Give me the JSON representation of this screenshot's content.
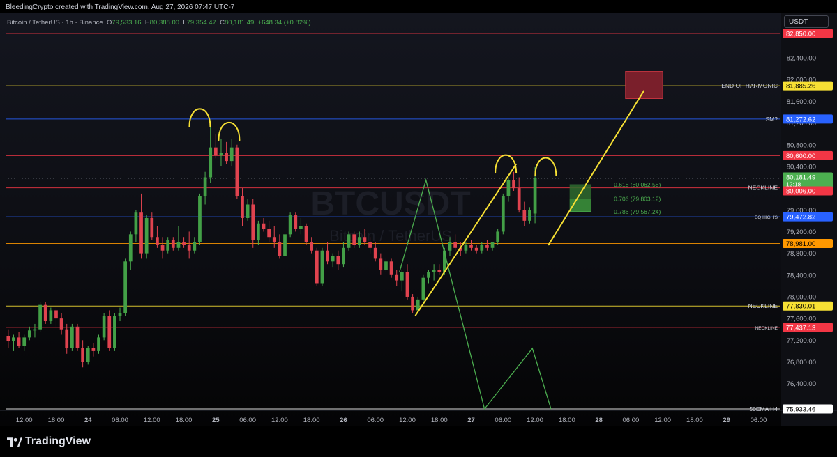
{
  "header": {
    "credit": "BleedingCrypto created with TradingView.com, Aug 27, 2026 07:47 UTC-7"
  },
  "legend": {
    "symbol": "Bitcoin / TetherUS · 1h · Binance",
    "o_label": "O",
    "o": "79,533.16",
    "h_label": "H",
    "h": "80,388.00",
    "l_label": "L",
    "l": "79,354.47",
    "c_label": "C",
    "c": "80,181.49",
    "change": "+648.34 (+0.82%)"
  },
  "currency": "USDT",
  "watermark": {
    "main": "BTCUSDT",
    "sub": "Bitcoin / TetherUS"
  },
  "brand": "TradingView",
  "chart_data": {
    "type": "candlestick",
    "ylim": [
      75933.46,
      82850
    ],
    "y_ticks": [
      76400,
      76800,
      77200,
      77600,
      78000,
      78400,
      78800,
      79200,
      79600,
      80000,
      80400,
      80800,
      81200,
      81600,
      82000,
      82400
    ],
    "x_ticks": [
      {
        "i": 3,
        "label": "12:00"
      },
      {
        "i": 9,
        "label": "18:00"
      },
      {
        "i": 15,
        "label": "24"
      },
      {
        "i": 21,
        "label": "06:00"
      },
      {
        "i": 27,
        "label": "12:00"
      },
      {
        "i": 33,
        "label": "18:00"
      },
      {
        "i": 39,
        "label": "25"
      },
      {
        "i": 45,
        "label": "06:00"
      },
      {
        "i": 51,
        "label": "12:00"
      },
      {
        "i": 57,
        "label": "18:00"
      },
      {
        "i": 63,
        "label": "26"
      },
      {
        "i": 69,
        "label": "06:00"
      },
      {
        "i": 75,
        "label": "12:00"
      },
      {
        "i": 81,
        "label": "18:00"
      },
      {
        "i": 87,
        "label": "27"
      },
      {
        "i": 93,
        "label": "06:00"
      },
      {
        "i": 99,
        "label": "12:00"
      },
      {
        "i": 105,
        "label": "18:00"
      },
      {
        "i": 111,
        "label": "28"
      },
      {
        "i": 117,
        "label": "06:00"
      },
      {
        "i": 123,
        "label": "12:00"
      },
      {
        "i": 129,
        "label": "18:00"
      },
      {
        "i": 135,
        "label": "29"
      },
      {
        "i": 141,
        "label": "06:00"
      }
    ],
    "x_span": [
      -0.5,
      145
    ],
    "candles": [
      [
        77280,
        77400,
        77050,
        77180
      ],
      [
        77180,
        77300,
        77000,
        77250
      ],
      [
        77250,
        77350,
        77050,
        77100
      ],
      [
        77100,
        77300,
        77000,
        77250
      ],
      [
        77250,
        77450,
        77200,
        77380
      ],
      [
        77380,
        77500,
        77250,
        77400
      ],
      [
        77400,
        77900,
        77350,
        77850
      ],
      [
        77850,
        77900,
        77500,
        77550
      ],
      [
        77550,
        77800,
        77500,
        77750
      ],
      [
        77750,
        77800,
        77450,
        77600
      ],
      [
        77600,
        77700,
        77300,
        77400
      ],
      [
        77400,
        77500,
        76950,
        77050
      ],
      [
        77050,
        77500,
        77000,
        77450
      ],
      [
        77450,
        77500,
        77000,
        77050
      ],
      [
        77050,
        77200,
        76700,
        76800
      ],
      [
        76800,
        77100,
        76750,
        77050
      ],
      [
        77050,
        77150,
        76900,
        77000
      ],
      [
        77000,
        77300,
        76950,
        77250
      ],
      [
        77250,
        77700,
        77200,
        77650
      ],
      [
        77650,
        77750,
        77000,
        77050
      ],
      [
        77050,
        77700,
        77000,
        77650
      ],
      [
        77650,
        77800,
        77550,
        77700
      ],
      [
        77700,
        78700,
        77650,
        78650
      ],
      [
        78650,
        79200,
        78500,
        79150
      ],
      [
        79150,
        79600,
        79000,
        79550
      ],
      [
        79550,
        79900,
        78700,
        78800
      ],
      [
        78800,
        79500,
        78700,
        79450
      ],
      [
        79450,
        79550,
        79050,
        79100
      ],
      [
        79100,
        79300,
        78900,
        78950
      ],
      [
        78950,
        79100,
        78700,
        78850
      ],
      [
        78850,
        79100,
        78800,
        79050
      ],
      [
        79050,
        79100,
        78850,
        78900
      ],
      [
        78900,
        79300,
        78850,
        79000
      ],
      [
        79000,
        79100,
        78900,
        78950
      ],
      [
        78950,
        79200,
        78700,
        78850
      ],
      [
        78850,
        79100,
        78800,
        79000
      ],
      [
        79000,
        79900,
        78950,
        79850
      ],
      [
        79850,
        80300,
        79700,
        80200
      ],
      [
        80200,
        81250,
        80100,
        80750
      ],
      [
        80750,
        81000,
        80550,
        80600
      ],
      [
        80600,
        80900,
        80400,
        80650
      ],
      [
        80650,
        80850,
        80450,
        80500
      ],
      [
        80500,
        80900,
        80400,
        80750
      ],
      [
        80750,
        80800,
        79800,
        79850
      ],
      [
        79850,
        80000,
        79300,
        79450
      ],
      [
        79450,
        79800,
        79400,
        79700
      ],
      [
        79700,
        79800,
        78900,
        79050
      ],
      [
        79050,
        79400,
        78950,
        79350
      ],
      [
        79350,
        79450,
        79200,
        79250
      ],
      [
        79250,
        79400,
        79000,
        79100
      ],
      [
        79100,
        79300,
        78900,
        79000
      ],
      [
        79000,
        79150,
        78700,
        78750
      ],
      [
        78750,
        79200,
        78700,
        79150
      ],
      [
        79150,
        79550,
        79100,
        79500
      ],
      [
        79500,
        79550,
        79200,
        79250
      ],
      [
        79250,
        79450,
        79150,
        79300
      ],
      [
        79300,
        79350,
        78950,
        79000
      ],
      [
        79000,
        79100,
        78800,
        78850
      ],
      [
        78850,
        78900,
        78200,
        78250
      ],
      [
        78250,
        78900,
        78200,
        78850
      ],
      [
        78850,
        79000,
        78600,
        78650
      ],
      [
        78650,
        78800,
        78550,
        78750
      ],
      [
        78750,
        78850,
        78500,
        78600
      ],
      [
        78600,
        79000,
        78550,
        78900
      ],
      [
        78900,
        79200,
        78850,
        79150
      ],
      [
        79150,
        79200,
        78900,
        78950
      ],
      [
        78950,
        79200,
        78900,
        79100
      ],
      [
        79100,
        79250,
        78950,
        79000
      ],
      [
        79000,
        79100,
        78800,
        78900
      ],
      [
        78900,
        79000,
        78650,
        78700
      ],
      [
        78700,
        78800,
        78400,
        78500
      ],
      [
        78500,
        78700,
        78450,
        78650
      ],
      [
        78650,
        78700,
        78350,
        78400
      ],
      [
        78400,
        78500,
        78200,
        78300
      ],
      [
        78300,
        78500,
        78100,
        78450
      ],
      [
        78450,
        78600,
        77950,
        78000
      ],
      [
        78000,
        78050,
        77700,
        77750
      ],
      [
        77750,
        78000,
        77700,
        77950
      ],
      [
        77950,
        78400,
        77850,
        78350
      ],
      [
        78350,
        78500,
        78250,
        78450
      ],
      [
        78450,
        78600,
        78300,
        78500
      ],
      [
        78500,
        78600,
        78400,
        78450
      ],
      [
        78450,
        78900,
        78400,
        78850
      ],
      [
        78850,
        79100,
        78750,
        79000
      ],
      [
        79000,
        79150,
        78850,
        78900
      ],
      [
        78900,
        79000,
        78750,
        78850
      ],
      [
        78850,
        79000,
        78800,
        78950
      ],
      [
        78950,
        79050,
        78850,
        78900
      ],
      [
        78900,
        78950,
        78800,
        78850
      ],
      [
        78850,
        79000,
        78800,
        78950
      ],
      [
        78950,
        79050,
        78850,
        78900
      ],
      [
        78900,
        79000,
        78850,
        79000
      ],
      [
        79000,
        79250,
        78950,
        79200
      ],
      [
        79200,
        79900,
        79150,
        79850
      ],
      [
        79850,
        80200,
        79750,
        80150
      ],
      [
        80150,
        80300,
        79950,
        80000
      ],
      [
        80000,
        80200,
        79550,
        79600
      ],
      [
        79600,
        79750,
        79300,
        79400
      ],
      [
        79400,
        79650,
        79350,
        79600
      ],
      [
        79533.16,
        80388,
        79354.47,
        80181.49
      ]
    ],
    "horizontal_lines": [
      {
        "price": 82850,
        "color": "#f23645",
        "tag": "82,850.00",
        "label": ""
      },
      {
        "price": 81885.26,
        "color": "#f7e034",
        "tag": "81,885.26",
        "label": "END OF HARMONIC"
      },
      {
        "price": 81272.62,
        "color": "#2962ff",
        "tag": "81,272.62",
        "label": "SM?"
      },
      {
        "price": 80600,
        "color": "#f23645",
        "tag": "80,600.00",
        "label": ""
      },
      {
        "price": 80006,
        "color": "#f23645",
        "tag": "80,006.00",
        "label": "NECKLINE"
      },
      {
        "price": 79472.82,
        "color": "#2962ff",
        "tag": "79,472.82",
        "label": "EQ HIGH'S"
      },
      {
        "price": 78981,
        "color": "#ff9800",
        "tag": "78,981.00",
        "label": ""
      },
      {
        "price": 77830.01,
        "color": "#f7e034",
        "tag": "77,830.01",
        "label": "NECKLINE"
      },
      {
        "price": 77437.13,
        "color": "#f23645",
        "tag": "77,437.13",
        "label": "NECKLINE"
      },
      {
        "price": 75933.46,
        "color": "#ffffff",
        "tag": "75,933.46",
        "label": "50EMA H4"
      }
    ],
    "last_price": {
      "price": 80181.49,
      "tag": "80,181.49",
      "countdown": "12:18"
    },
    "fib_levels": [
      {
        "price": 80062.58,
        "label": "0.618 (80,062.58)"
      },
      {
        "price": 79803.12,
        "label": "0.706 (79,803.12)"
      },
      {
        "price": 79567.24,
        "label": "0.786 (79,567.24)"
      }
    ],
    "target_box": {
      "i0": 116,
      "i1": 123,
      "p_top": 82150,
      "p_bottom": 81650
    },
    "yellow_lines": [
      [
        [
          76.5,
          77650
        ],
        [
          95.5,
          80450
        ]
      ],
      [
        [
          101.5,
          78950
        ],
        [
          119.5,
          81800
        ]
      ]
    ],
    "green_zigzag": [
      [
        73.5,
        78450
      ],
      [
        78.5,
        80150
      ],
      [
        89.5,
        75933.46
      ],
      [
        98.5,
        77050
      ],
      [
        102,
        75933.46
      ]
    ],
    "arches": [
      {
        "i": 36,
        "p": 81350
      },
      {
        "i": 41.5,
        "p": 81100
      },
      {
        "i": 93.5,
        "p": 80500
      },
      {
        "i": 101,
        "p": 80450
      }
    ],
    "legend_colors": {
      "up": "#26a69a",
      "down": "#ef5350"
    }
  }
}
